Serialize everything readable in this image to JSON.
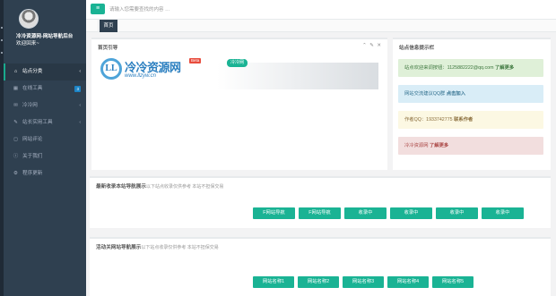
{
  "sidebar": {
    "profile": {
      "name": "冷冷资源网-网站导航后台",
      "subtitle": "欢迎回来~"
    },
    "items": [
      {
        "label": "站点分类",
        "icon": "home-icon",
        "glyph": "⌂",
        "arrow": "‹"
      },
      {
        "label": "在线工具",
        "icon": "grid-icon",
        "glyph": "▦",
        "badge": "3"
      },
      {
        "label": "冷冷网",
        "icon": "mail-icon",
        "glyph": "✉",
        "arrow": "‹"
      },
      {
        "label": "站长实用工具",
        "icon": "edit-icon",
        "glyph": "✎",
        "arrow": "‹"
      },
      {
        "label": "网站评论",
        "icon": "comment-icon",
        "glyph": "◻"
      },
      {
        "label": "关于我们",
        "icon": "info-icon",
        "glyph": "ⓘ"
      },
      {
        "label": "程序更新",
        "icon": "gear-icon",
        "glyph": "⚙"
      }
    ]
  },
  "topbar": {
    "search_placeholder": "请输入您需要查找的内容 …"
  },
  "tabs": {
    "home": "首页"
  },
  "panels": {
    "main": {
      "title": "首页引导",
      "tools": "⌃ ✎ ✕",
      "logo": {
        "mark": "LL",
        "name": "冷冷资源网",
        "badge": "Beta",
        "url": "www.llzyw.cn"
      },
      "pill": "冷冷网"
    },
    "notice": {
      "title": "站点信息提示栏",
      "alerts": [
        {
          "text": "站点欢迎来调按钮：1125882222@qq.com",
          "link": "了解更多",
          "tone": "green"
        },
        {
          "text": "网站交流建议QQ群",
          "link": "点击加入",
          "tone": "blue"
        },
        {
          "text": "作者QQ：1933742775",
          "link": "联系作者",
          "tone": "yellow"
        },
        {
          "text": "冷冷资源网",
          "link": "了解更多",
          "tone": "red"
        }
      ]
    },
    "latest": {
      "title": "最新收录本站导航展示",
      "hint": "以下站点收录仅供参考 本站不担保交易",
      "buttons": [
        "F网站导航",
        "F网站导航",
        "收录中",
        "收录中",
        "收录中",
        "收录中"
      ]
    },
    "active": {
      "title": "活动关网站导航展示",
      "hint": "以下站点收录仅供参考 本站不担保交易",
      "buttons": [
        "网站名称1",
        "网站名称2",
        "网站名称3",
        "网站名称4",
        "网站名称5"
      ]
    }
  },
  "colors": {
    "sidebar_bg": "#2f4050",
    "accent": "#1ab394",
    "badge": "#1c84c6"
  }
}
